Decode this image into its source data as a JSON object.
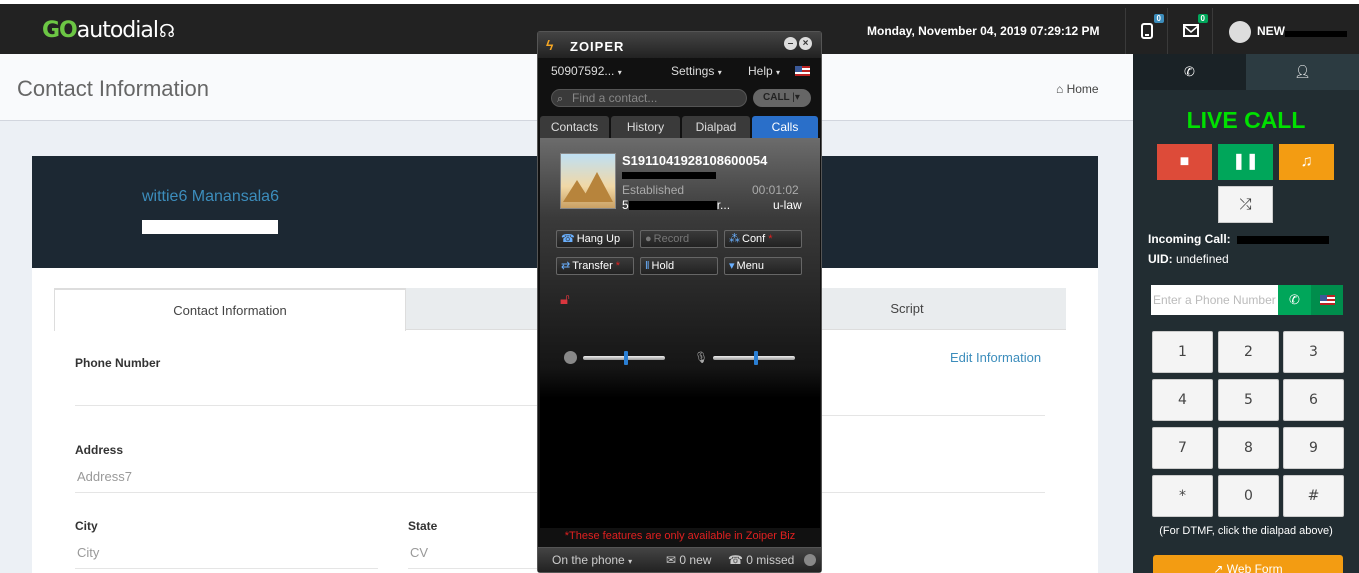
{
  "header": {
    "logo_go": "GO",
    "logo_rest": "autodial",
    "datetime": "Monday, November 04, 2019 07:29:12 PM",
    "phone_badge": "0",
    "mail_badge": "0",
    "username": "NEW"
  },
  "page": {
    "title": "Contact Information",
    "breadcrumb_home": "Home"
  },
  "contact": {
    "name": "wittie6 Manansala6",
    "tabs": [
      "Contact Information",
      "Script"
    ],
    "edit_link": "Edit Information",
    "fields": {
      "phone_label": "Phone Number",
      "address_label": "Address",
      "address_value": "Address7",
      "city_label": "City",
      "city_value": "City",
      "state_label": "State",
      "state_value": "CV"
    }
  },
  "zoiper": {
    "title": "ZOIPER",
    "account": "50907592...",
    "menu_settings": "Settings",
    "menu_help": "Help",
    "search_placeholder": "Find a contact...",
    "call_button": "CALL",
    "tabs": [
      "Contacts",
      "History",
      "Dialpad",
      "Calls"
    ],
    "active_tab": "Calls",
    "call": {
      "caller_id": "S1911041928108600054",
      "status": "Established",
      "duration": "00:01:02",
      "number_prefix": "5",
      "number_suffix": "r...",
      "codec": "u-law"
    },
    "buttons": {
      "hang_up": "Hang Up",
      "record": "Record",
      "conf": "Conf",
      "transfer": "Transfer",
      "hold": "Hold",
      "menu": "Menu"
    },
    "speaker_level": 0.52,
    "mic_level": 0.52,
    "notice": "*These features are only available in Zoiper Biz",
    "footer": {
      "presence": "On the phone",
      "new_messages": "0 new",
      "missed_calls": "0 missed"
    }
  },
  "sidebar": {
    "live_call_label": "LIVE CALL",
    "incoming_label": "Incoming Call:",
    "uid_label": "UID:",
    "uid_value": "undefined",
    "phone_placeholder": "Enter a Phone Number",
    "keypad": [
      "1",
      "2",
      "3",
      "4",
      "5",
      "6",
      "7",
      "8",
      "9",
      "*",
      "0",
      "#"
    ],
    "dtmf_hint": "(For DTMF, click the dialpad above)",
    "web_form": "Web Form",
    "colors": {
      "hangup": "#dd4b39",
      "pause": "#00a65a",
      "music": "#f39c12"
    }
  }
}
